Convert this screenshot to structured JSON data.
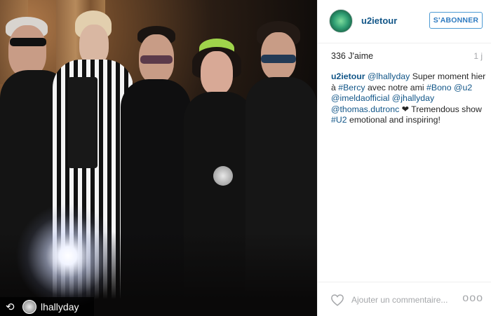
{
  "photo": {
    "regram_badge": {
      "icon": "repost-icon",
      "username": "lhallyday"
    }
  },
  "header": {
    "username": "u2ietour",
    "follow_label": "S'ABONNER"
  },
  "meta": {
    "likes": "336 J'aime",
    "time": "1 j"
  },
  "caption": {
    "author": "u2ietour",
    "segments": [
      {
        "t": "@lhallyday",
        "hl": true
      },
      {
        "t": " Super moment hier à ",
        "hl": false
      },
      {
        "t": "#Bercy",
        "hl": true
      },
      {
        "t": " avec notre ami ",
        "hl": false
      },
      {
        "t": "#Bono",
        "hl": true
      },
      {
        "t": " ",
        "hl": false
      },
      {
        "t": "@u2",
        "hl": true
      },
      {
        "t": " ",
        "hl": false
      },
      {
        "t": "@imeldaofficial",
        "hl": true
      },
      {
        "t": " ",
        "hl": false
      },
      {
        "t": "@jhallyday",
        "hl": true
      },
      {
        "t": " ",
        "hl": false
      },
      {
        "t": "@thomas.dutronc",
        "hl": true
      },
      {
        "t": " ❤",
        "hl": false
      },
      {
        "t": " Tremendous show ",
        "hl": false
      },
      {
        "t": "#U2",
        "hl": true
      },
      {
        "t": " emotional and inspiring!",
        "hl": false
      }
    ]
  },
  "footer": {
    "comment_placeholder": "Ajouter un commentaire...",
    "more_label": "ooo"
  },
  "colors": {
    "link": "#125688",
    "follow_border": "#4d9ad3",
    "muted": "#a5a7aa"
  }
}
